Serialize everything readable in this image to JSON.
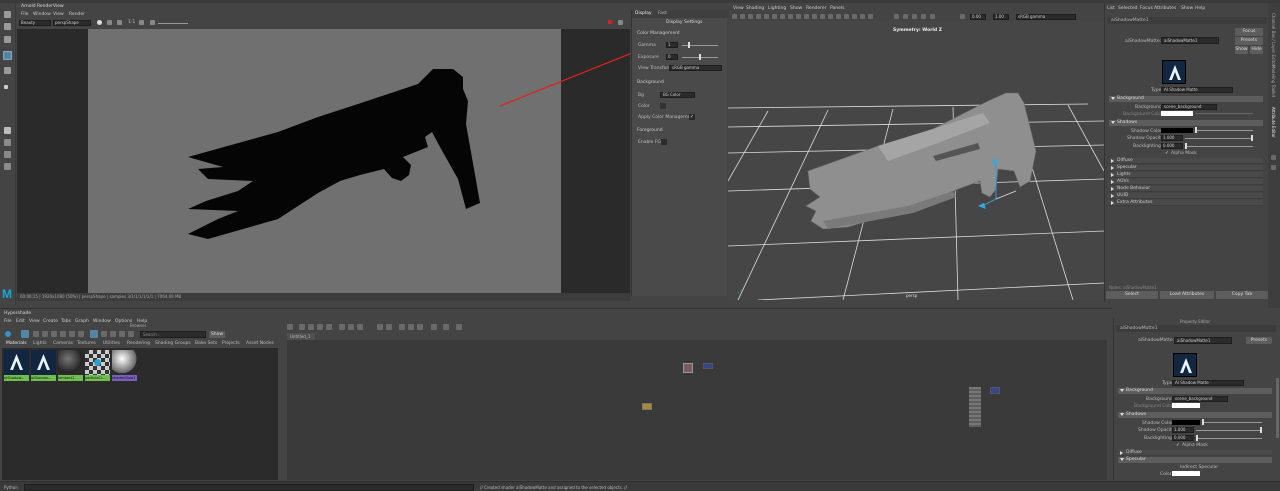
{
  "render_view": {
    "title": "Arnold RenderView",
    "menu": [
      "File",
      "Window",
      "View",
      "Render"
    ],
    "channel": "Beauty",
    "camera": "perspShape",
    "ratio": "1:1",
    "status": "00:00:15 | 1920x1080 (50%) | perspShape | samples 3/1/1/1/1/1/1 | 7064.09 MB"
  },
  "display_panel": {
    "tabs": [
      "Display",
      "Fast"
    ],
    "title": "Display Settings",
    "color_mgmt_header": "Color Management",
    "gamma_label": "Gamma",
    "gamma_value": "1",
    "exposure_label": "Exposure",
    "exposure_value": "0",
    "view_transform_label": "View Transform",
    "view_transform_value": "sRGB gamma",
    "background_header": "Background",
    "bg_label": "Bg",
    "bg_value": "BG Color",
    "color_label": "Color",
    "apply_cm_label": "Apply Color Management",
    "foreground_header": "Foreground",
    "enable_fg_label": "Enable FG"
  },
  "viewport": {
    "menu": [
      "View",
      "Shading",
      "Lighting",
      "Show",
      "Renderer",
      "Panels"
    ],
    "hud_title": "Symmetry: World Z",
    "camera_label": "persp",
    "value_a": "0.00",
    "value_b": "1.00",
    "colorspace": "sRGB gamma"
  },
  "attr_editor_top": {
    "menu": [
      "List",
      "Selected",
      "Focus",
      "Attributes",
      "Show",
      "Help"
    ],
    "tab": "aiShadowMatte1",
    "node_label": "aiShadowMatte:",
    "node_value": "aiShadowMatte1",
    "focus_btn": "Focus",
    "presets_btn": "Presets",
    "show_btn": "Show",
    "hide_btn": "Hide",
    "type_label": "Type",
    "type_value": "AI Shadow Matte",
    "sections": {
      "background": "Background",
      "shadows": "Shadows",
      "diffuse": "Diffuse",
      "specular": "Specular",
      "lights": "Lights",
      "aovs": "AOVs",
      "node_behavior": "Node Behavior",
      "uuid": "UUID",
      "extra": "Extra Attributes"
    },
    "background_label": "Background",
    "background_value": "scene_background",
    "background_color_label": "Background Color",
    "shadow_color_label": "Shadow Color",
    "shadow_opacity_label": "Shadow Opacity",
    "shadow_opacity_value": "1.000",
    "backlighting_label": "Backlighting",
    "backlighting_value": "0.000",
    "alpha_mask_label": "Alpha Mask",
    "notes_label": "Notes: aiShadowMatte1",
    "select_btn": "Select",
    "load_btn": "Load Attributes",
    "copy_btn": "Copy Tab",
    "side_tabs": [
      "Channel Box / Layer Editor",
      "Modeling Toolkit",
      "Attribute Editor"
    ]
  },
  "hypershade": {
    "title": "Hypershade",
    "menu": [
      "File",
      "Edit",
      "View",
      "Create",
      "Tabs",
      "Graph",
      "Window",
      "Options",
      "Help"
    ],
    "browser_label": "Browser",
    "search_placeholder": "Search...",
    "show_btn": "Show",
    "tabs": [
      "Materials",
      "Lights",
      "Cameras",
      "Textures",
      "Utilities",
      "Rendering",
      "Shading Groups",
      "Bake Sets",
      "Projects",
      "Asset Nodes"
    ],
    "materials": [
      {
        "name": "aiShadow...",
        "kind": "shadowmatte",
        "color": "#6fbf4f"
      },
      {
        "name": "aiStandar...",
        "kind": "shadowmatte",
        "color": "#6fbf4f"
      },
      {
        "name": "lambert1",
        "kind": "sphere-dark",
        "color": "#6fbf4f"
      },
      {
        "name": "particleCl...",
        "kind": "checker",
        "color": "#6fbf4f"
      },
      {
        "name": "shaderGlow1",
        "kind": "sphere-light",
        "color": "#7a5fbf"
      }
    ],
    "graph_tab": "Untitled_1",
    "graph_header": "Material Viewer"
  },
  "attr_editor_bottom": {
    "header": "Property Editor",
    "node_label": "aiShadowMatte:",
    "node_value": "aiShadowMatte1",
    "presets_btn": "Presets",
    "type_label": "Type",
    "type_value": "AI Shadow Matte",
    "background_header": "Background",
    "background_label": "Background",
    "background_value": "scene_background",
    "background_color_label": "Background Color",
    "shadows_header": "Shadows",
    "shadow_color_label": "Shadow Color",
    "shadow_opacity_label": "Shadow Opacity",
    "shadow_opacity_value": "1.000",
    "backlighting_label": "Backlighting",
    "backlighting_value": "0.000",
    "alpha_mask_label": "Alpha Mask",
    "diffuse_header": "Diffuse",
    "specular_header": "Specular",
    "indirect_specular_label": "Indirect Specular",
    "color_label": "Color"
  },
  "status_bar": {
    "mode": "Python",
    "message": "// Created shader aiShadowMatte and assigned to the selected objects. //"
  },
  "colors": {
    "render_bg": "#707070",
    "accent_red": "#e02020",
    "selected_blue": "#5285a6",
    "maya_logo": "#1aa6d6"
  }
}
